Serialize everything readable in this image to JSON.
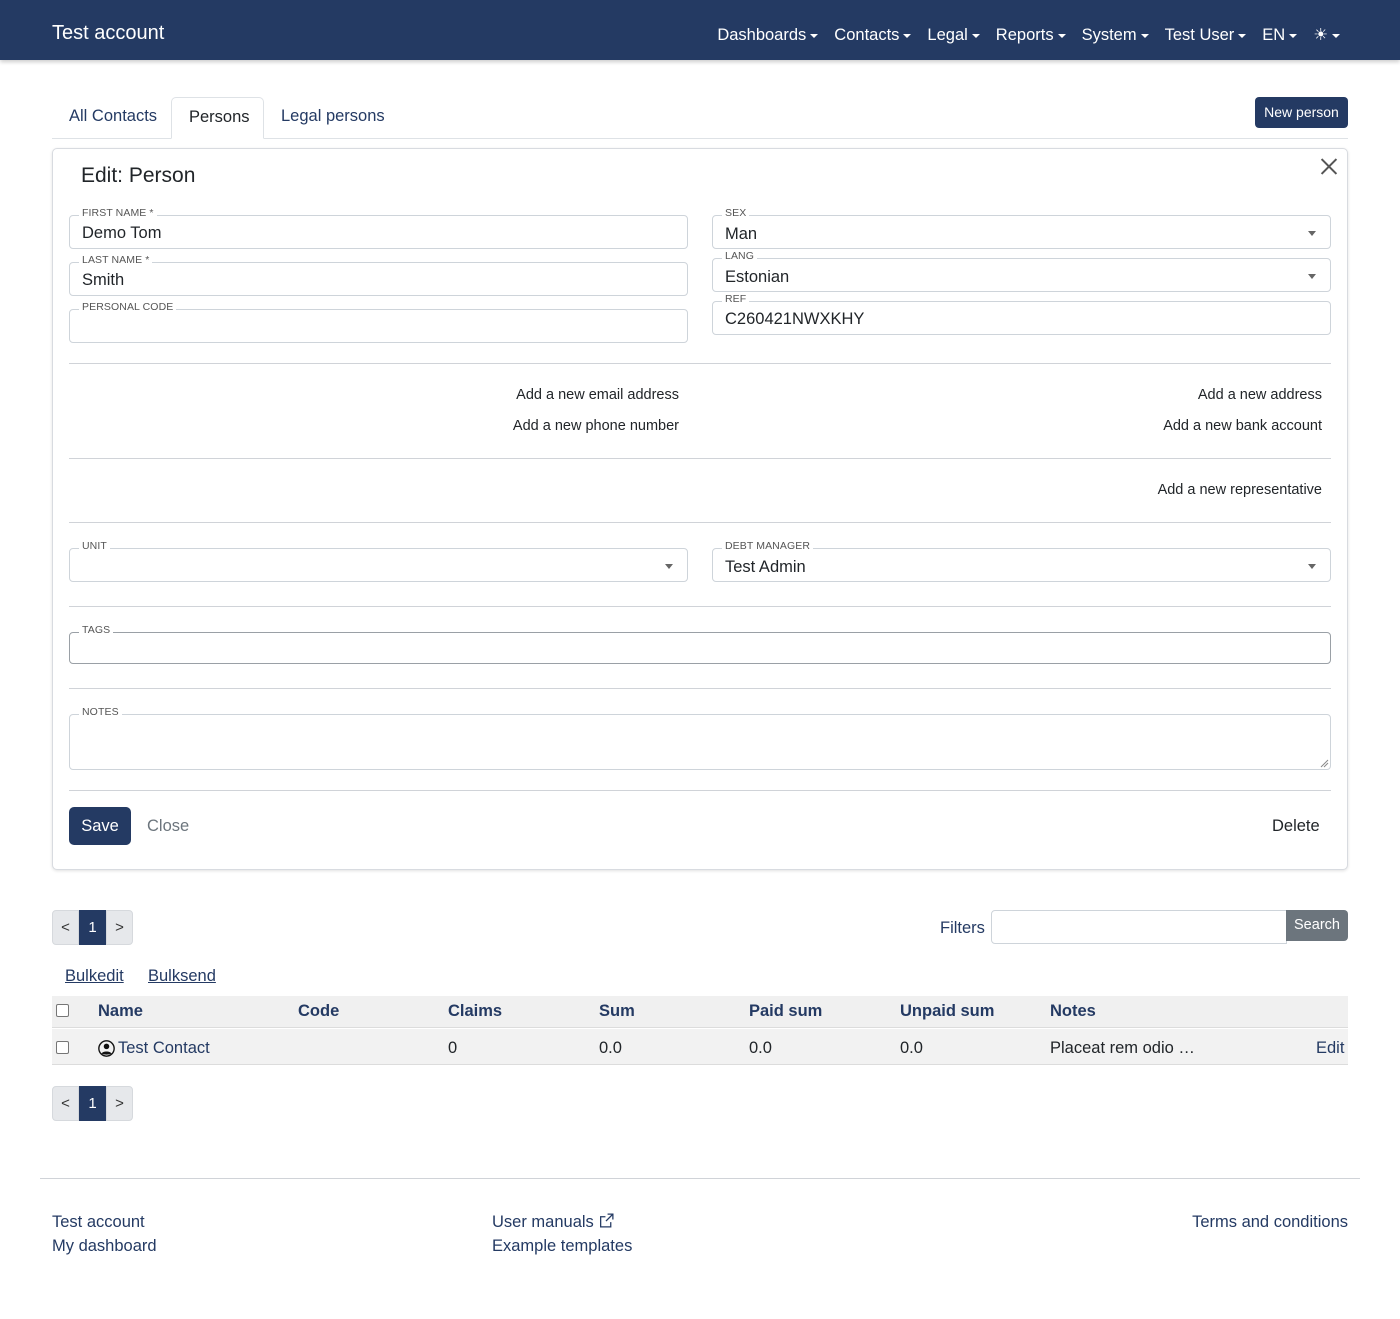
{
  "navbar": {
    "brand": "Test account",
    "items": [
      {
        "label": "Dashboards"
      },
      {
        "label": "Contacts"
      },
      {
        "label": "Legal"
      },
      {
        "label": "Reports"
      },
      {
        "label": "System"
      },
      {
        "label": "Test User"
      },
      {
        "label": "EN"
      },
      {
        "label": "☀"
      }
    ]
  },
  "tabs": [
    {
      "label": "All Contacts"
    },
    {
      "label": "Persons",
      "active": true
    },
    {
      "label": "Legal persons"
    }
  ],
  "new_person_label": "New person",
  "form": {
    "title": "Edit: Person",
    "first_name": {
      "label": "FIRST NAME *",
      "value": "Demo Tom"
    },
    "last_name": {
      "label": "LAST NAME *",
      "value": "Smith"
    },
    "personal_code": {
      "label": "PERSONAL CODE",
      "value": ""
    },
    "sex": {
      "label": "SEX",
      "value": "Man"
    },
    "lang": {
      "label": "LANG",
      "value": "Estonian"
    },
    "ref": {
      "label": "REF",
      "value": "C260421NWXKHY"
    },
    "add_email": "Add a new email address",
    "add_phone": "Add a new phone number",
    "add_address": "Add a new address",
    "add_bank": "Add a new bank account",
    "add_representative": "Add a new representative",
    "unit": {
      "label": "UNIT",
      "value": ""
    },
    "debt_manager": {
      "label": "DEBT MANAGER",
      "value": "Test Admin"
    },
    "tags": {
      "label": "TAGS",
      "value": ""
    },
    "notes": {
      "label": "NOTES",
      "value": ""
    },
    "save": "Save",
    "close": "Close",
    "delete": "Delete"
  },
  "pager": {
    "prev": "<",
    "page": "1",
    "next": ">"
  },
  "filters": {
    "label": "Filters",
    "value": "",
    "search": "Search"
  },
  "bulk": {
    "edit": "Bulkedit",
    "send": "Bulksend"
  },
  "table": {
    "headers": [
      "Name",
      "Code",
      "Claims",
      "Sum",
      "Paid sum",
      "Unpaid sum",
      "Notes"
    ],
    "rows": [
      {
        "name": "Test Contact",
        "code": "",
        "claims": "0",
        "sum": "0.0",
        "paid": "0.0",
        "unpaid": "0.0",
        "notes": "Placeat rem odio …",
        "edit": "Edit"
      }
    ]
  },
  "footer": {
    "col1": [
      "Test account",
      "My dashboard"
    ],
    "col2": [
      "User manuals",
      "Example templates"
    ],
    "col3": [
      "Terms and conditions"
    ]
  },
  "colors": {
    "primary": "#243a63",
    "secondary": "#6c757d"
  }
}
